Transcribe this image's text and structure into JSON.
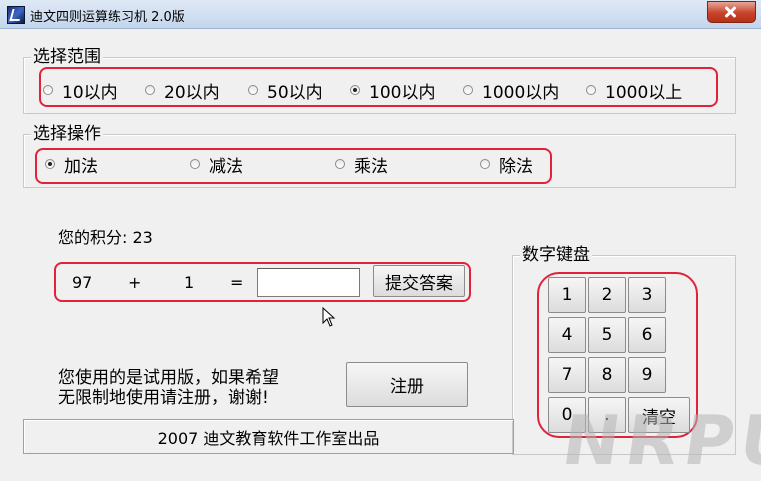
{
  "window": {
    "title": "迪文四则运算练习机  2.0版"
  },
  "range_group": {
    "title": "选择范围",
    "options": [
      {
        "label": "10以内",
        "checked": false
      },
      {
        "label": "20以内",
        "checked": false
      },
      {
        "label": "50以内",
        "checked": false
      },
      {
        "label": "100以内",
        "checked": true
      },
      {
        "label": "1000以内",
        "checked": false
      },
      {
        "label": "1000以上",
        "checked": false
      }
    ]
  },
  "operation_group": {
    "title": "选择操作",
    "options": [
      {
        "label": "加法",
        "checked": true
      },
      {
        "label": "减法",
        "checked": false
      },
      {
        "label": "乘法",
        "checked": false
      },
      {
        "label": "除法",
        "checked": false
      }
    ]
  },
  "score": {
    "text": "您的积分: 23"
  },
  "problem": {
    "operand1": "97",
    "operator": "+",
    "operand2": "1",
    "equals": "=",
    "answer_value": "",
    "submit_label": "提交答案"
  },
  "trial": {
    "message_line1": "您使用的是试用版，如果希望",
    "message_line2": "无限制地使用请注册，谢谢!",
    "register_label": "注册"
  },
  "keypad": {
    "title": "数字键盘",
    "keys": [
      "1",
      "2",
      "3",
      "4",
      "5",
      "6",
      "7",
      "8",
      "9",
      "0",
      ".",
      "清空"
    ]
  },
  "statusbar": {
    "text": "2007 迪文教育软件工作室出品"
  },
  "watermark": {
    "text": "NRPUN"
  },
  "colors": {
    "highlight": "#e0223b",
    "window_bg": "#f0f0f0",
    "close_button": "#c8432b"
  }
}
